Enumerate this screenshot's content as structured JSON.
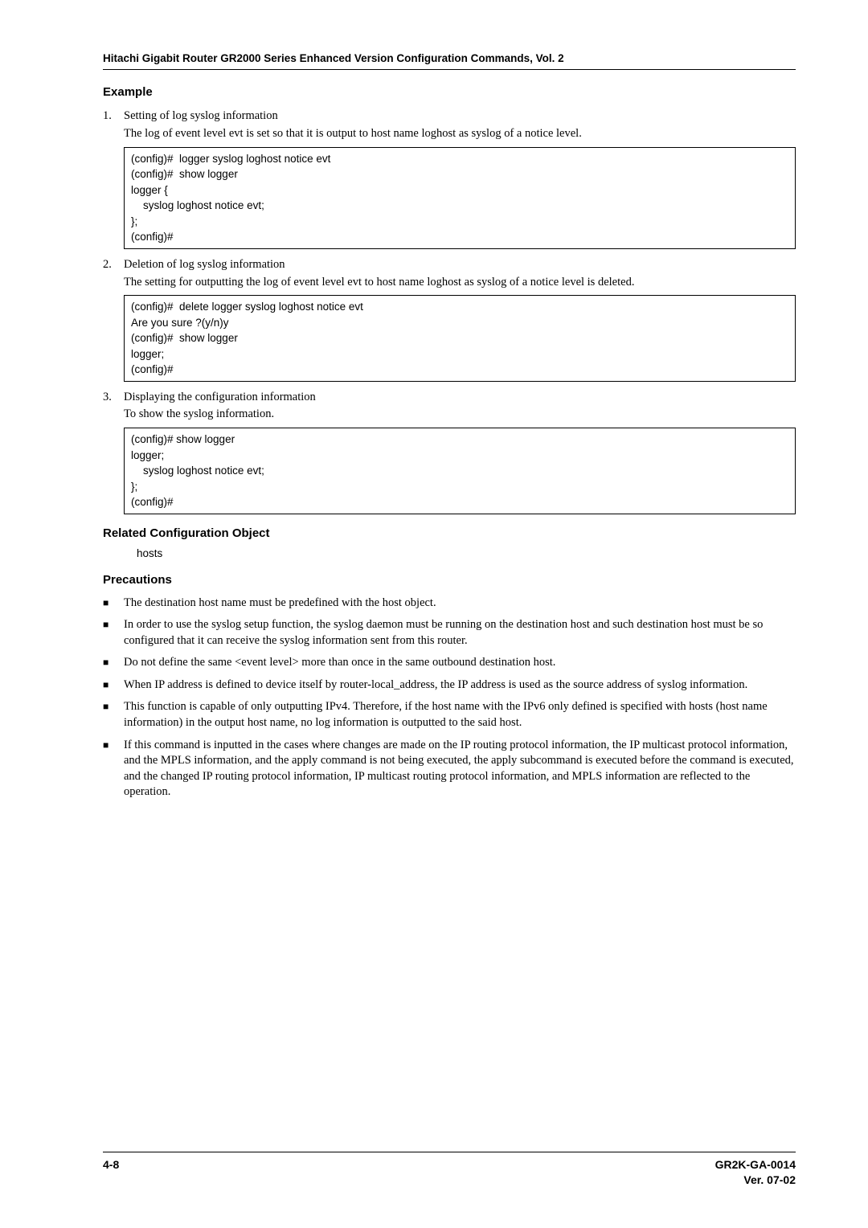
{
  "running_head": "Hitachi Gigabit Router GR2000 Series Enhanced Version Configuration Commands, Vol. 2",
  "sections": {
    "example_h": "Example",
    "ex1": {
      "num": "1.",
      "title": "Setting of log syslog information",
      "desc": "The log of event level evt is set so that it is output to host name loghost as syslog of a notice level.",
      "code": "(config)#  logger syslog loghost notice evt\n(config)#  show logger\nlogger {\n    syslog loghost notice evt;\n};\n(config)#"
    },
    "ex2": {
      "num": "2.",
      "title": "Deletion of log syslog information",
      "desc": "The setting for outputting the log of event level evt to host name loghost as syslog of a notice level is deleted.",
      "code": "(config)#  delete logger syslog loghost notice evt\nAre you sure ?(y/n)y\n(config)#  show logger\nlogger;\n(config)#"
    },
    "ex3": {
      "num": "3.",
      "title": "Displaying the configuration information",
      "desc": "To show the syslog information.",
      "code": "(config)# show logger\nlogger;\n    syslog loghost notice evt;\n};\n(config)#"
    },
    "related_h": "Related Configuration Object",
    "related_val": "hosts",
    "precautions_h": "Precautions",
    "bullets": [
      "The destination host name must be predefined with the host object.",
      "In order to use the syslog setup function, the syslog daemon must be running on the destination host and such destination host must be so configured that it can receive the syslog information sent from this router.",
      "Do not define the same <event level> more than once in the same outbound destination host.",
      "When IP address is defined to device itself by router-local_address, the IP address is used as the source address of syslog information.",
      "This function is capable of only outputting IPv4. Therefore, if the host name with the IPv6 only defined is specified with hosts (host name information) in the output host name, no log information is outputted to the said host.",
      "If this command is inputted in the cases where changes are made on the IP routing protocol information, the IP multicast protocol information, and the MPLS information, and the apply command is not being executed, the apply subcommand is executed before the command is executed, and the changed IP routing protocol information, IP multicast routing protocol information, and MPLS information are reflected to the operation."
    ]
  },
  "footer": {
    "left": "4-8",
    "right1": "GR2K-GA-0014",
    "right2": "Ver. 07-02"
  }
}
